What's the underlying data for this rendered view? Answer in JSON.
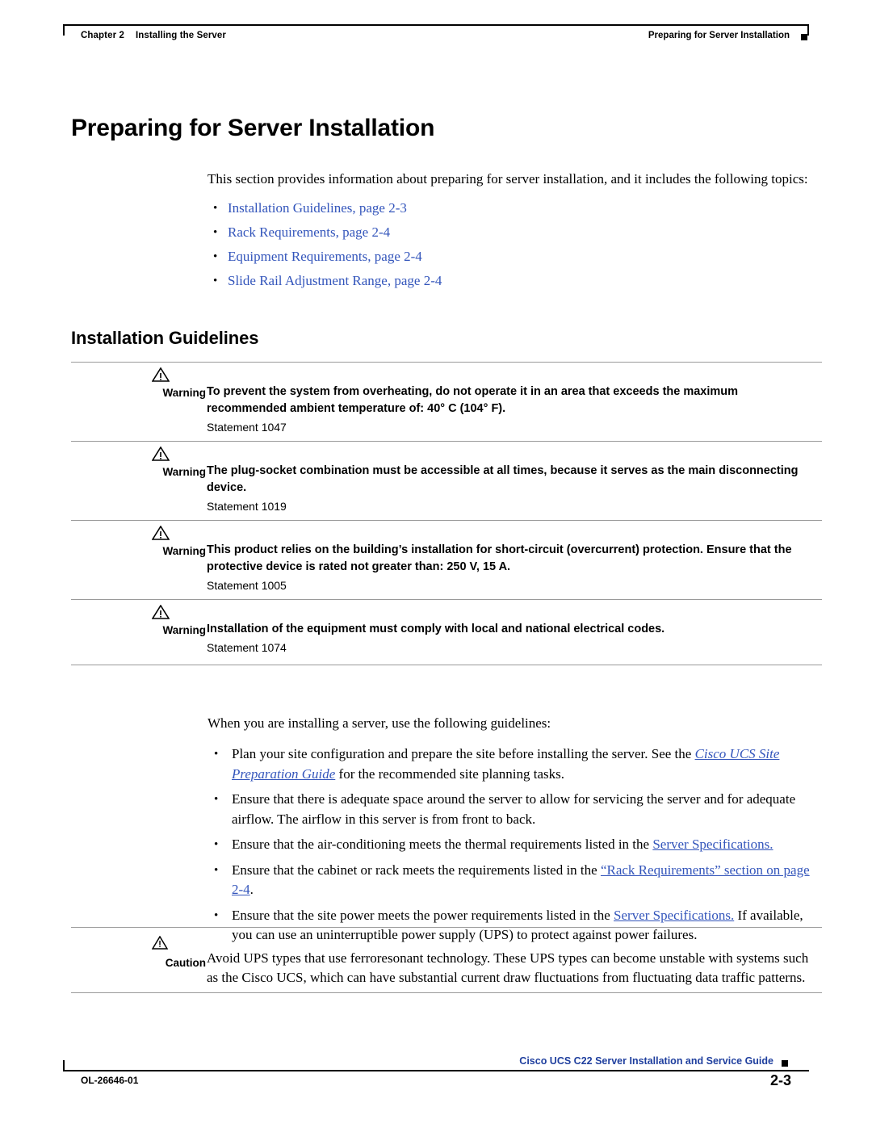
{
  "header": {
    "chapter_label": "Chapter 2",
    "chapter_title": "Installing the Server",
    "running_head": "Preparing for Server Installation"
  },
  "page": {
    "h1": "Preparing for Server Installation",
    "intro": "This section provides information about preparing for server installation, and it includes the following topics:",
    "h2": "Installation Guidelines"
  },
  "toc": {
    "bullet": "•",
    "items": [
      {
        "label": "Installation Guidelines, page 2-3"
      },
      {
        "label": "Rack Requirements, page 2-4"
      },
      {
        "label": "Equipment Requirements, page 2-4"
      },
      {
        "label": "Slide Rail Adjustment Range, page 2-4"
      }
    ]
  },
  "notices": [
    {
      "label": "Warning",
      "text": "To prevent the system from overheating, do not operate it in an area that exceeds the maximum recommended ambient temperature of: 40° C (104° F).",
      "statement": "Statement 1047"
    },
    {
      "label": "Warning",
      "text": "The plug-socket combination must be accessible at all times, because it serves as the main disconnecting device.",
      "statement": "Statement 1019"
    },
    {
      "label": "Warning",
      "text": "This product relies on the building’s installation for short-circuit (overcurrent) protection. Ensure that the protective device is rated not greater than: 250 V, 15 A.",
      "statement": "Statement 1005"
    },
    {
      "label": "Warning",
      "text": "Installation of the equipment must comply with local and national electrical codes.",
      "statement": "Statement 1074"
    }
  ],
  "body": {
    "lead": "When you are installing a server, use the following guidelines:",
    "bullet": "•",
    "items": [
      {
        "pre": "Plan your site configuration and prepare the site before installing the server. See the ",
        "link": "Cisco UCS Site Preparation Guide",
        "link_style": "italic",
        "post": " for the recommended site planning tasks."
      },
      {
        "pre": "Ensure that there is adequate space around the server to allow for servicing the server and for adequate airflow. The airflow in this server is from front to back.",
        "link": "",
        "link_style": "none",
        "post": ""
      },
      {
        "pre": "Ensure that the air-conditioning meets the thermal requirements listed in the ",
        "link": "Server Specifications.",
        "link_style": "normal",
        "post": ""
      },
      {
        "pre": "Ensure that the cabinet or rack meets the requirements listed in the ",
        "link": "“Rack Requirements” section on page 2-4",
        "link_style": "normal",
        "post": "."
      },
      {
        "pre": "Ensure that the site power meets the power requirements listed in the ",
        "link": "Server Specifications.",
        "link_style": "normal",
        "post": " If available, you can use an uninterruptible power supply (UPS) to protect against power failures."
      }
    ]
  },
  "caution": {
    "label": "Caution",
    "text": "Avoid UPS types that use ferroresonant technology. These UPS types can become unstable with systems such as the Cisco UCS, which can have substantial current draw fluctuations from fluctuating data traffic patterns."
  },
  "footer": {
    "doc_id": "OL-26646-01",
    "title": "Cisco UCS C22 Server Installation and Service Guide",
    "page_number": "2-3"
  },
  "colors": {
    "link": "#3355bb",
    "footer_title": "#1f3f9e",
    "rule": "#9a9a9a"
  }
}
